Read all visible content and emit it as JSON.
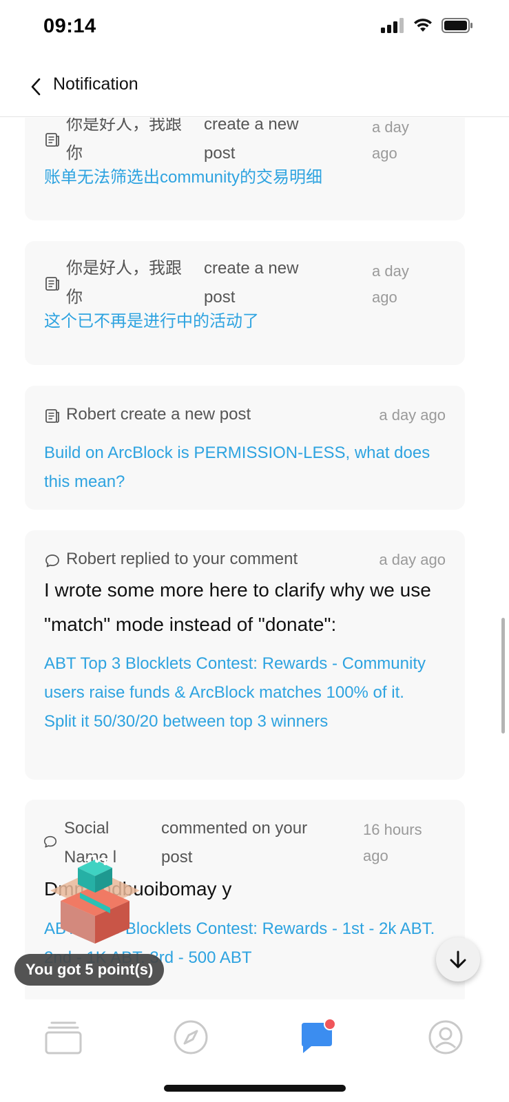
{
  "status_bar": {
    "time": "09:14"
  },
  "header": {
    "title": "Notification"
  },
  "notifications": [
    {
      "icon": "post-icon",
      "actor": "你是好人，我跟你",
      "action": "create a new post",
      "time": "a day ago",
      "link": "账单无法筛选出community的交易明细"
    },
    {
      "icon": "post-icon",
      "actor": "你是好人，我跟你",
      "action": "create a new post",
      "time": "a day ago",
      "link": "这个已不再是进行中的活动了"
    },
    {
      "icon": "post-icon",
      "actor": "Robert",
      "action": "create a new post",
      "time": "a day ago",
      "link": "Build on ArcBlock is PERMISSION-LESS, what does this mean?"
    },
    {
      "icon": "comment-icon",
      "actor": "Robert",
      "action": "replied to your comment",
      "time": "a day ago",
      "body": "I wrote some more here to clarify why we use \"match\" mode instead of \"donate\":",
      "link": "ABT Top 3 Blocklets Contest: Rewards - Community users raise funds & ArcBlock matches 100% of it. Split it 50/30/20 between top 3 winners"
    },
    {
      "icon": "comment-icon",
      "actor": "Social Name l",
      "action": "commented on your post",
      "time": "16 hours ago",
      "body": "Dmm, ndbuoibomay y",
      "link": "ABT Top 3 Blocklets Contest: Rewards - 1st - 2k ABT. 2nd - 1K ABT. 3rd - 500 ABT"
    }
  ],
  "toast": {
    "text": "You got 5 point(s)"
  },
  "tab_bar": {
    "tabs": [
      "cards-icon",
      "explore-compass-icon",
      "notification-chat-icon",
      "profile-icon"
    ],
    "active_index": 2,
    "accent": "#3b8df0",
    "badge_color": "#f0555a"
  }
}
